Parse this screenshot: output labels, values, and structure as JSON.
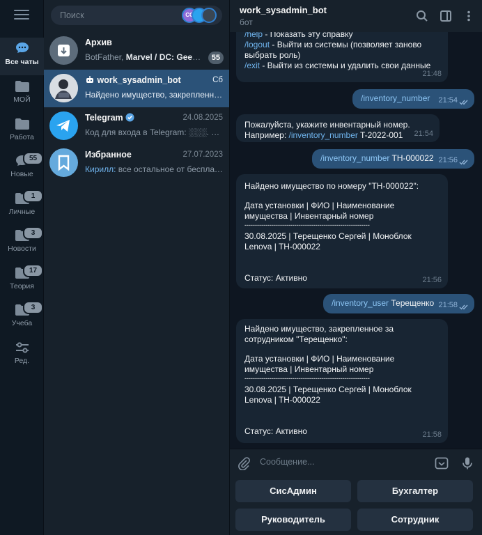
{
  "rail": {
    "items": [
      {
        "label": "Все чаты",
        "badge": ""
      },
      {
        "label": "МОЙ",
        "badge": ""
      },
      {
        "label": "Работа",
        "badge": ""
      },
      {
        "label": "Новые",
        "badge": "55"
      },
      {
        "label": "Личные",
        "badge": "1"
      },
      {
        "label": "Новости",
        "badge": "3"
      },
      {
        "label": "Теория",
        "badge": "17"
      },
      {
        "label": "Учеба",
        "badge": "3"
      },
      {
        "label": "Ред.",
        "badge": ""
      }
    ]
  },
  "search": {
    "placeholder": "Поиск",
    "story_initials": "CC"
  },
  "chats": [
    {
      "name": "Архив",
      "date": "",
      "preview_sender": "BotFather, ",
      "preview_bold": "Marvel / DC: Geek M...",
      "badge": "55"
    },
    {
      "name": "work_sysadmin_bot",
      "date": "Сб",
      "preview": "Найдено имущество, закрепленное за сотрудником"
    },
    {
      "name": "Telegram",
      "date": "24.08.2025",
      "preview": "Код для входа в Telegram: ░░░. Не давайте код никому"
    },
    {
      "name": "Избранное",
      "date": "27.07.2023",
      "preview_sender": "Кирилл: ",
      "preview": "все остальное от бесплатного"
    }
  ],
  "header": {
    "title": "work_sysadmin_bot",
    "subtitle": "бот"
  },
  "messages": {
    "m1": {
      "help_cmd": "/help",
      "help_txt": " - Показать эту справку",
      "logout_cmd": "/logout",
      "logout_txt": " - Выйти из системы (позволяет заново выбрать роль)",
      "exit_cmd": "/exit",
      "exit_txt": " - Выйти из системы и удалить свои данные",
      "time": "21:48"
    },
    "m2": {
      "cmd": "/inventory_number",
      "time": "21:54"
    },
    "m3": {
      "text": "Пожалуйста, укажите инвентарный номер. Например: ",
      "cmd": "/inventory_number",
      "tail": " T-2022-001",
      "time": "21:54"
    },
    "m4": {
      "cmd": "/inventory_number",
      "tail": " TH-000022",
      "time": "21:56"
    },
    "m5": {
      "l1": "Найдено имущество по номеру \"TH-000022\":",
      "l2": "Дата установки | ФИО | Наименование имущества | Инвентарный номер",
      "l3": "------------------------------------------------------------",
      "l4": "30.08.2025 | Терещенко Сергей | Моноблок Lenova | TH-000022",
      "l5": "Статус: Активно",
      "time": "21:56"
    },
    "m6": {
      "cmd": "/inventory_user",
      "tail": " Терещенко",
      "time": "21:58"
    },
    "m7": {
      "l1": "Найдено имущество, закрепленное за сотрудником \"Терещенко\":",
      "l2": "Дата установки | ФИО | Наименование имущества | Инвентарный номер",
      "l3": "------------------------------------------------------------",
      "l4": "30.08.2025 | Терещенко Сергей | Моноблок Lenova | TH-000022",
      "l5": "Статус: Активно",
      "time": "21:58"
    }
  },
  "composer": {
    "placeholder": "Сообщение..."
  },
  "keyboard": {
    "b1": "СисАдмин",
    "b2": "Бухгалтер",
    "b3": "Руководитель",
    "b4": "Сотрудник"
  },
  "colors": {
    "accent": "#2b5278",
    "link": "#6fb3ec",
    "telegram_blue": "#2aa3ef",
    "saved_blue": "#65aadd"
  }
}
